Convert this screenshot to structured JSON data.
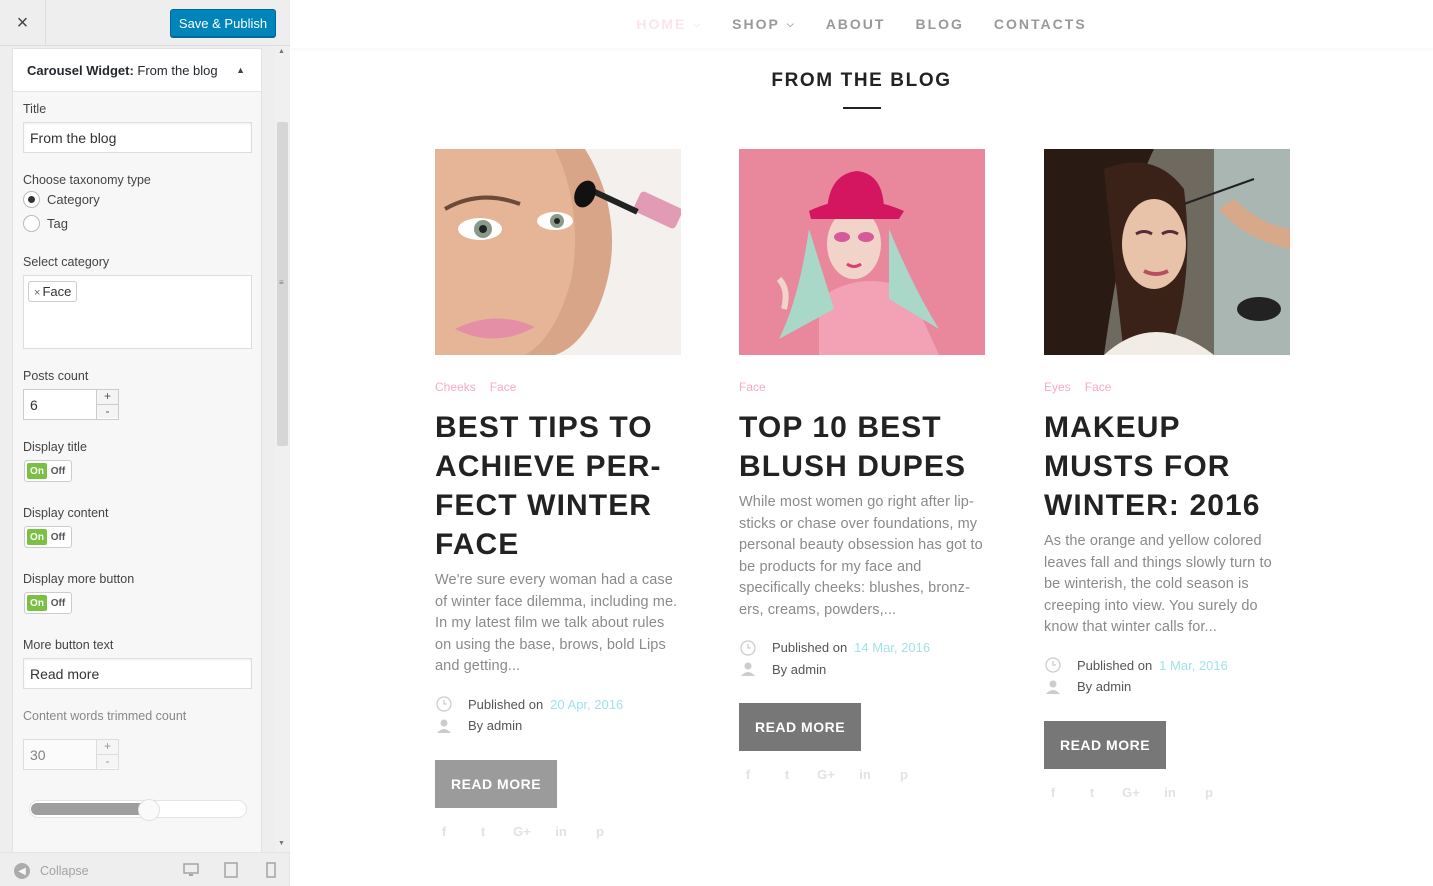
{
  "sidebar": {
    "close_symbol": "×",
    "save_label": "Save & Publish",
    "widget_title_prefix": "Carousel Widget:",
    "widget_title_name": "From the blog",
    "fields": {
      "title_label": "Title",
      "title_value": "From the blog",
      "taxonomy_label": "Choose taxonomy type",
      "taxonomy_options": [
        "Category",
        "Tag"
      ],
      "taxonomy_selected": "Category",
      "category_label": "Select category",
      "category_tag": "Face",
      "posts_count_label": "Posts count",
      "posts_count_value": "6",
      "display_title_label": "Display title",
      "display_content_label": "Display content",
      "display_more_label": "Display more button",
      "toggle_on": "On",
      "toggle_off": "Off",
      "more_text_label": "More button text",
      "more_text_value": "Read more",
      "trim_label": "Content words trimmed count",
      "trim_value": "30",
      "slider_level_percent": 55
    },
    "footer": {
      "collapse_label": "Collapse"
    }
  },
  "nav": {
    "items": [
      {
        "label": "HOME",
        "dropdown": true,
        "active": true
      },
      {
        "label": "SHOP",
        "dropdown": true,
        "active": false
      },
      {
        "label": "ABOUT",
        "dropdown": false,
        "active": false
      },
      {
        "label": "BLOG",
        "dropdown": false,
        "active": false
      },
      {
        "label": "CONTACTS",
        "dropdown": false,
        "active": false
      }
    ]
  },
  "section_title": "FROM THE BLOG",
  "posts": [
    {
      "categories": [
        "Cheeks",
        "Face"
      ],
      "title": "BEST TIPS TO ACHIEVE PER-FECT WINTER FACE",
      "excerpt": "We're sure every woman had a case of winter face dilemma, including me. In my latest film we talk about rules on using the base, brows, bold Lips and getting...",
      "published_label": "Published on",
      "date": "20 Apr, 2016",
      "by_label": "By",
      "author": "admin",
      "button": "READ MORE"
    },
    {
      "categories": [
        "Face"
      ],
      "title": "TOP 10 BEST BLUSH DUPES",
      "excerpt": "While most women go right after lip-sticks or chase over foundations, my personal beauty obsession has got to be products for my face and specifically cheeks: blushes, bronz-ers, creams, powders,...",
      "published_label": "Published on",
      "date": "14 Mar, 2016",
      "by_label": "By",
      "author": "admin",
      "button": "READ MORE"
    },
    {
      "categories": [
        "Eyes",
        "Face"
      ],
      "title": "MAKEUP MUSTS FOR WINTER: 2016",
      "excerpt": "As the orange and yellow colored leaves fall and things slowly turn to be winterish, the cold season is creeping into view. You surely do know that winter calls for...",
      "published_label": "Published on",
      "date": "1 Mar, 2016",
      "by_label": "By",
      "author": "admin",
      "button": "READ MORE"
    }
  ],
  "social_icons": [
    "facebook-icon",
    "twitter-icon",
    "google-plus-icon",
    "linkedin-icon",
    "pinterest-icon"
  ],
  "social_glyphs": [
    "f",
    "t",
    "G+",
    "in",
    "p"
  ],
  "colors": {
    "save_button": "#0085ba",
    "toggle_on": "#7ac143",
    "category_pink": "#f7a9c7",
    "date_cyan": "#9fe3ea",
    "button_gray": "#777777"
  }
}
